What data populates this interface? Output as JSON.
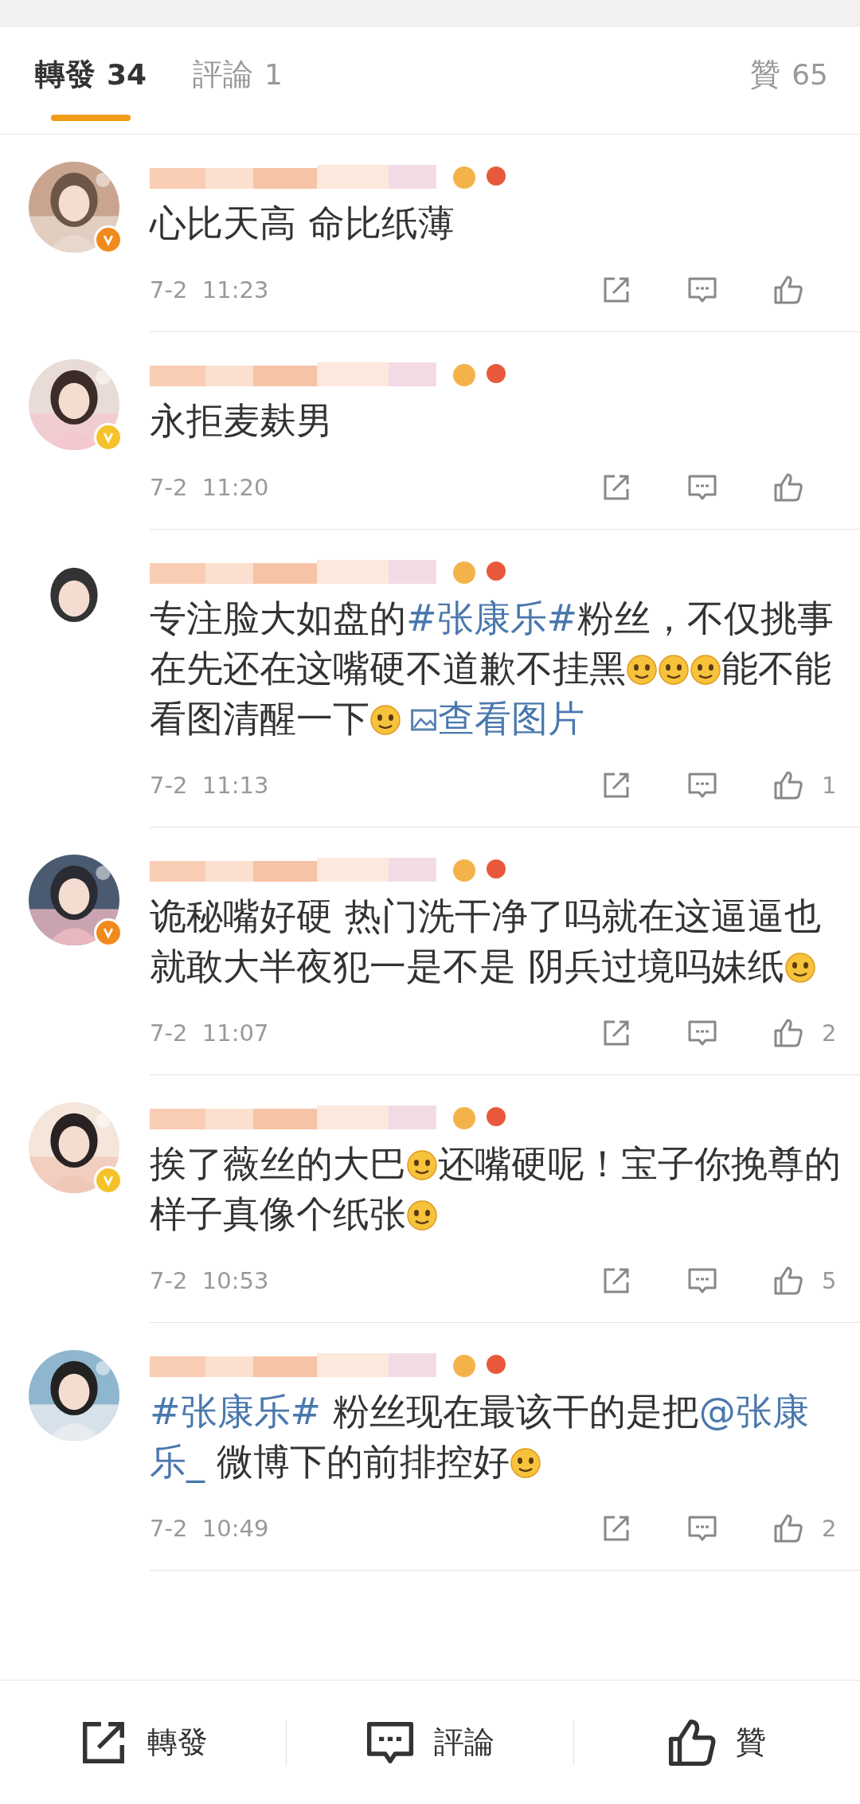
{
  "tabs": [
    {
      "label": "轉發",
      "count": "34",
      "selected": true
    },
    {
      "label": "評論",
      "count": "1",
      "selected": false
    }
  ],
  "likes_tab": {
    "label": "贊",
    "count": "65"
  },
  "comments": [
    {
      "badge": {
        "color": "#f08a1c"
      },
      "content": [
        {
          "kind": "text",
          "text": "心比天高 命比纸薄"
        }
      ],
      "time": "7-2  11:23"
    },
    {
      "badge": {
        "color": "#f5c22a"
      },
      "content": [
        {
          "kind": "text",
          "text": "永拒麦麸男"
        }
      ],
      "time": "7-2  11:20"
    },
    {
      "content": [
        {
          "kind": "text",
          "text": "专注脸大如盘的"
        },
        {
          "kind": "link",
          "text": "#张康乐#"
        },
        {
          "kind": "text",
          "text": "粉丝，不仅挑事在先还在这嘴硬不道歉不挂黑"
        },
        {
          "kind": "emoji"
        },
        {
          "kind": "emoji"
        },
        {
          "kind": "emoji"
        },
        {
          "kind": "text",
          "text": "能不能看图清醒一下"
        },
        {
          "kind": "emoji"
        },
        {
          "kind": "image_link",
          "text": "查看图片"
        }
      ],
      "time": "7-2  11:13",
      "like_count": "1"
    },
    {
      "badge": {
        "color": "#f08a1c"
      },
      "content": [
        {
          "kind": "text",
          "text": "诡秘嘴好硬 热门洗干净了吗就在这逼逼也就敢大半夜犯一是不是 阴兵过境吗妹纸"
        },
        {
          "kind": "emoji"
        }
      ],
      "time": "7-2  11:07",
      "like_count": "2"
    },
    {
      "badge": {
        "color": "#f5c22a"
      },
      "content": [
        {
          "kind": "text",
          "text": "挨了薇丝的大巴"
        },
        {
          "kind": "emoji"
        },
        {
          "kind": "text",
          "text": "还嘴硬呢！宝子你挽尊的样子真像个纸张"
        },
        {
          "kind": "emoji"
        }
      ],
      "time": "7-2  10:53",
      "like_count": "5"
    },
    {
      "content": [
        {
          "kind": "link",
          "text": "#张康乐#"
        },
        {
          "kind": "text",
          "text": " 粉丝现在最该干的是把"
        },
        {
          "kind": "link",
          "text": "@张康乐_"
        },
        {
          "kind": "text",
          "text": " 微博下的前排控好"
        },
        {
          "kind": "emoji"
        }
      ],
      "time": "7-2  10:49",
      "like_count": "2"
    }
  ],
  "bottom_bar": [
    {
      "kind": "repost",
      "label": "轉發"
    },
    {
      "kind": "comment",
      "label": "評論"
    },
    {
      "kind": "like",
      "label": "贊"
    }
  ]
}
